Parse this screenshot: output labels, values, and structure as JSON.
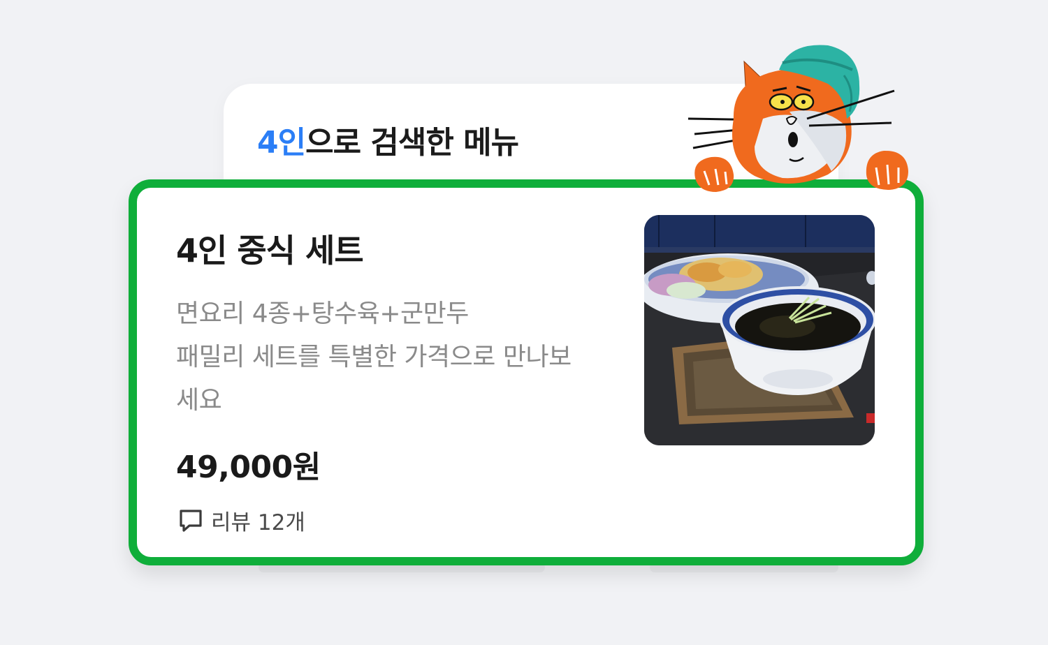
{
  "search_header": {
    "keyword": "4인",
    "suffix": "으로 검색한 메뉴"
  },
  "menu_item": {
    "name": "4인 중식 세트",
    "description_lines": [
      "면요리 4종+탕수육+군만두",
      "패밀리 세트를 특별한 가격으로 만나보",
      "세요"
    ],
    "price": "49,000원",
    "reviews_label": "리뷰 12개",
    "image_icon": "food-photo"
  },
  "colors": {
    "accent_blue": "#2b7ef6",
    "highlight_green": "#0fae3a",
    "mascot_orange": "#f06a1e",
    "mascot_teal": "#2cb3a4"
  }
}
